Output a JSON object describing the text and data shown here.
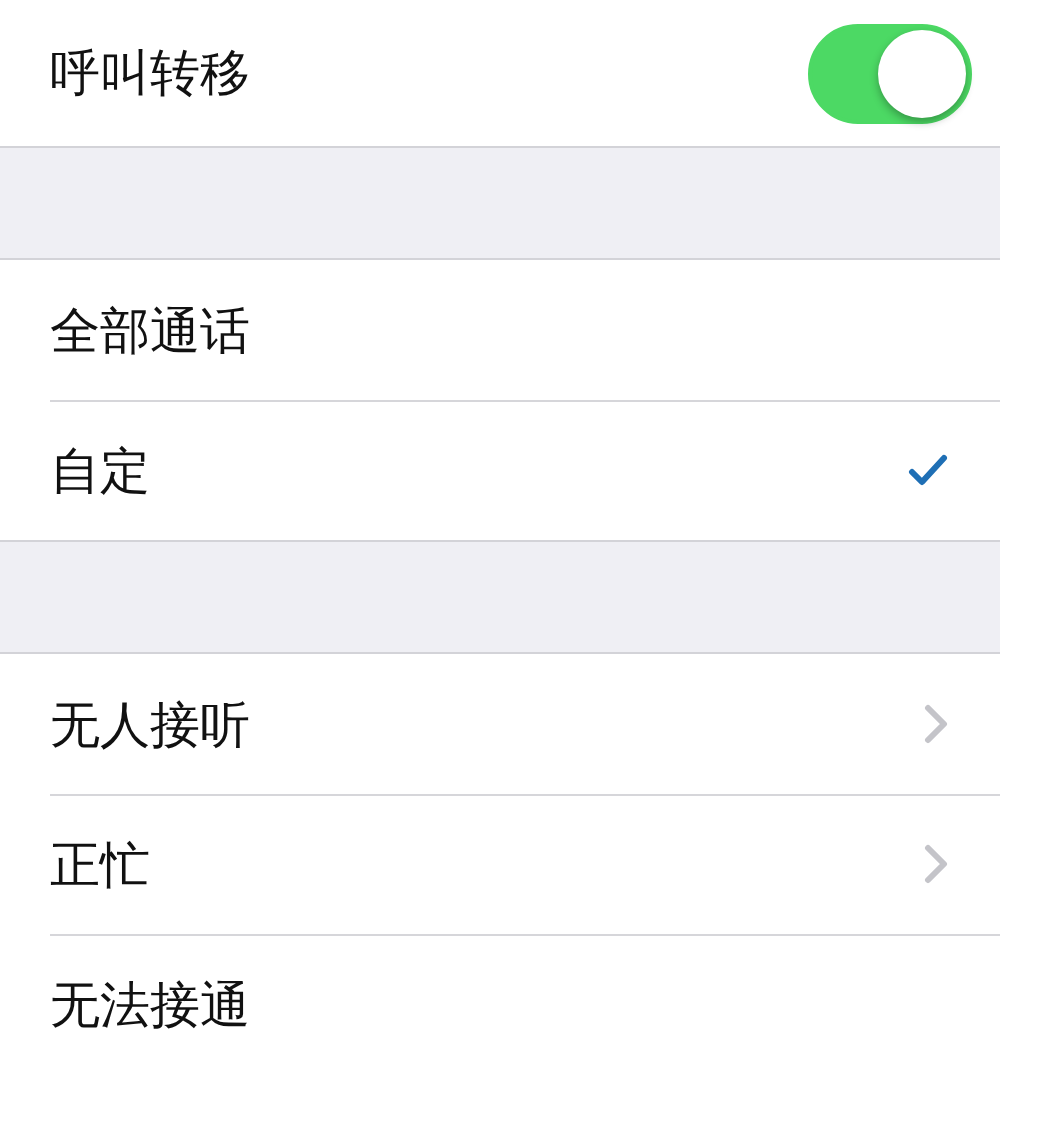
{
  "call_forwarding": {
    "label": "呼叫转移",
    "on": true
  },
  "forward_modes": [
    {
      "label": "全部通话",
      "selected": false
    },
    {
      "label": "自定",
      "selected": true
    }
  ],
  "conditions": [
    {
      "label": "无人接听",
      "kind": "chevron"
    },
    {
      "label": "正忙",
      "kind": "chevron"
    },
    {
      "label": "无法接通",
      "kind": "plain"
    }
  ]
}
